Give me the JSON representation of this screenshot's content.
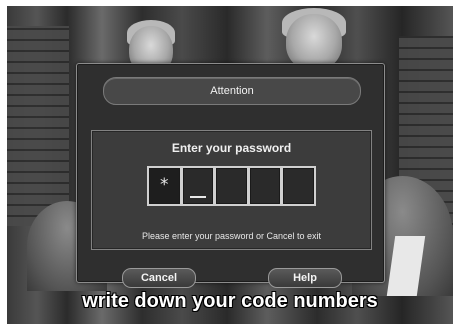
{
  "dialog": {
    "title": "Attention",
    "prompt": "Enter your password",
    "pin": {
      "slots": 5,
      "filled": 1,
      "mask_char": "*"
    },
    "help_text": "Please enter your password or Cancel to exit",
    "buttons": {
      "cancel_label": "Cancel",
      "help_label": "Help"
    }
  },
  "subtitle": "write down your code numbers",
  "colors": {
    "dialog_bg": "#2f2f2f",
    "panel_bg": "#3c3c3c",
    "text": "#f0f0f0"
  }
}
